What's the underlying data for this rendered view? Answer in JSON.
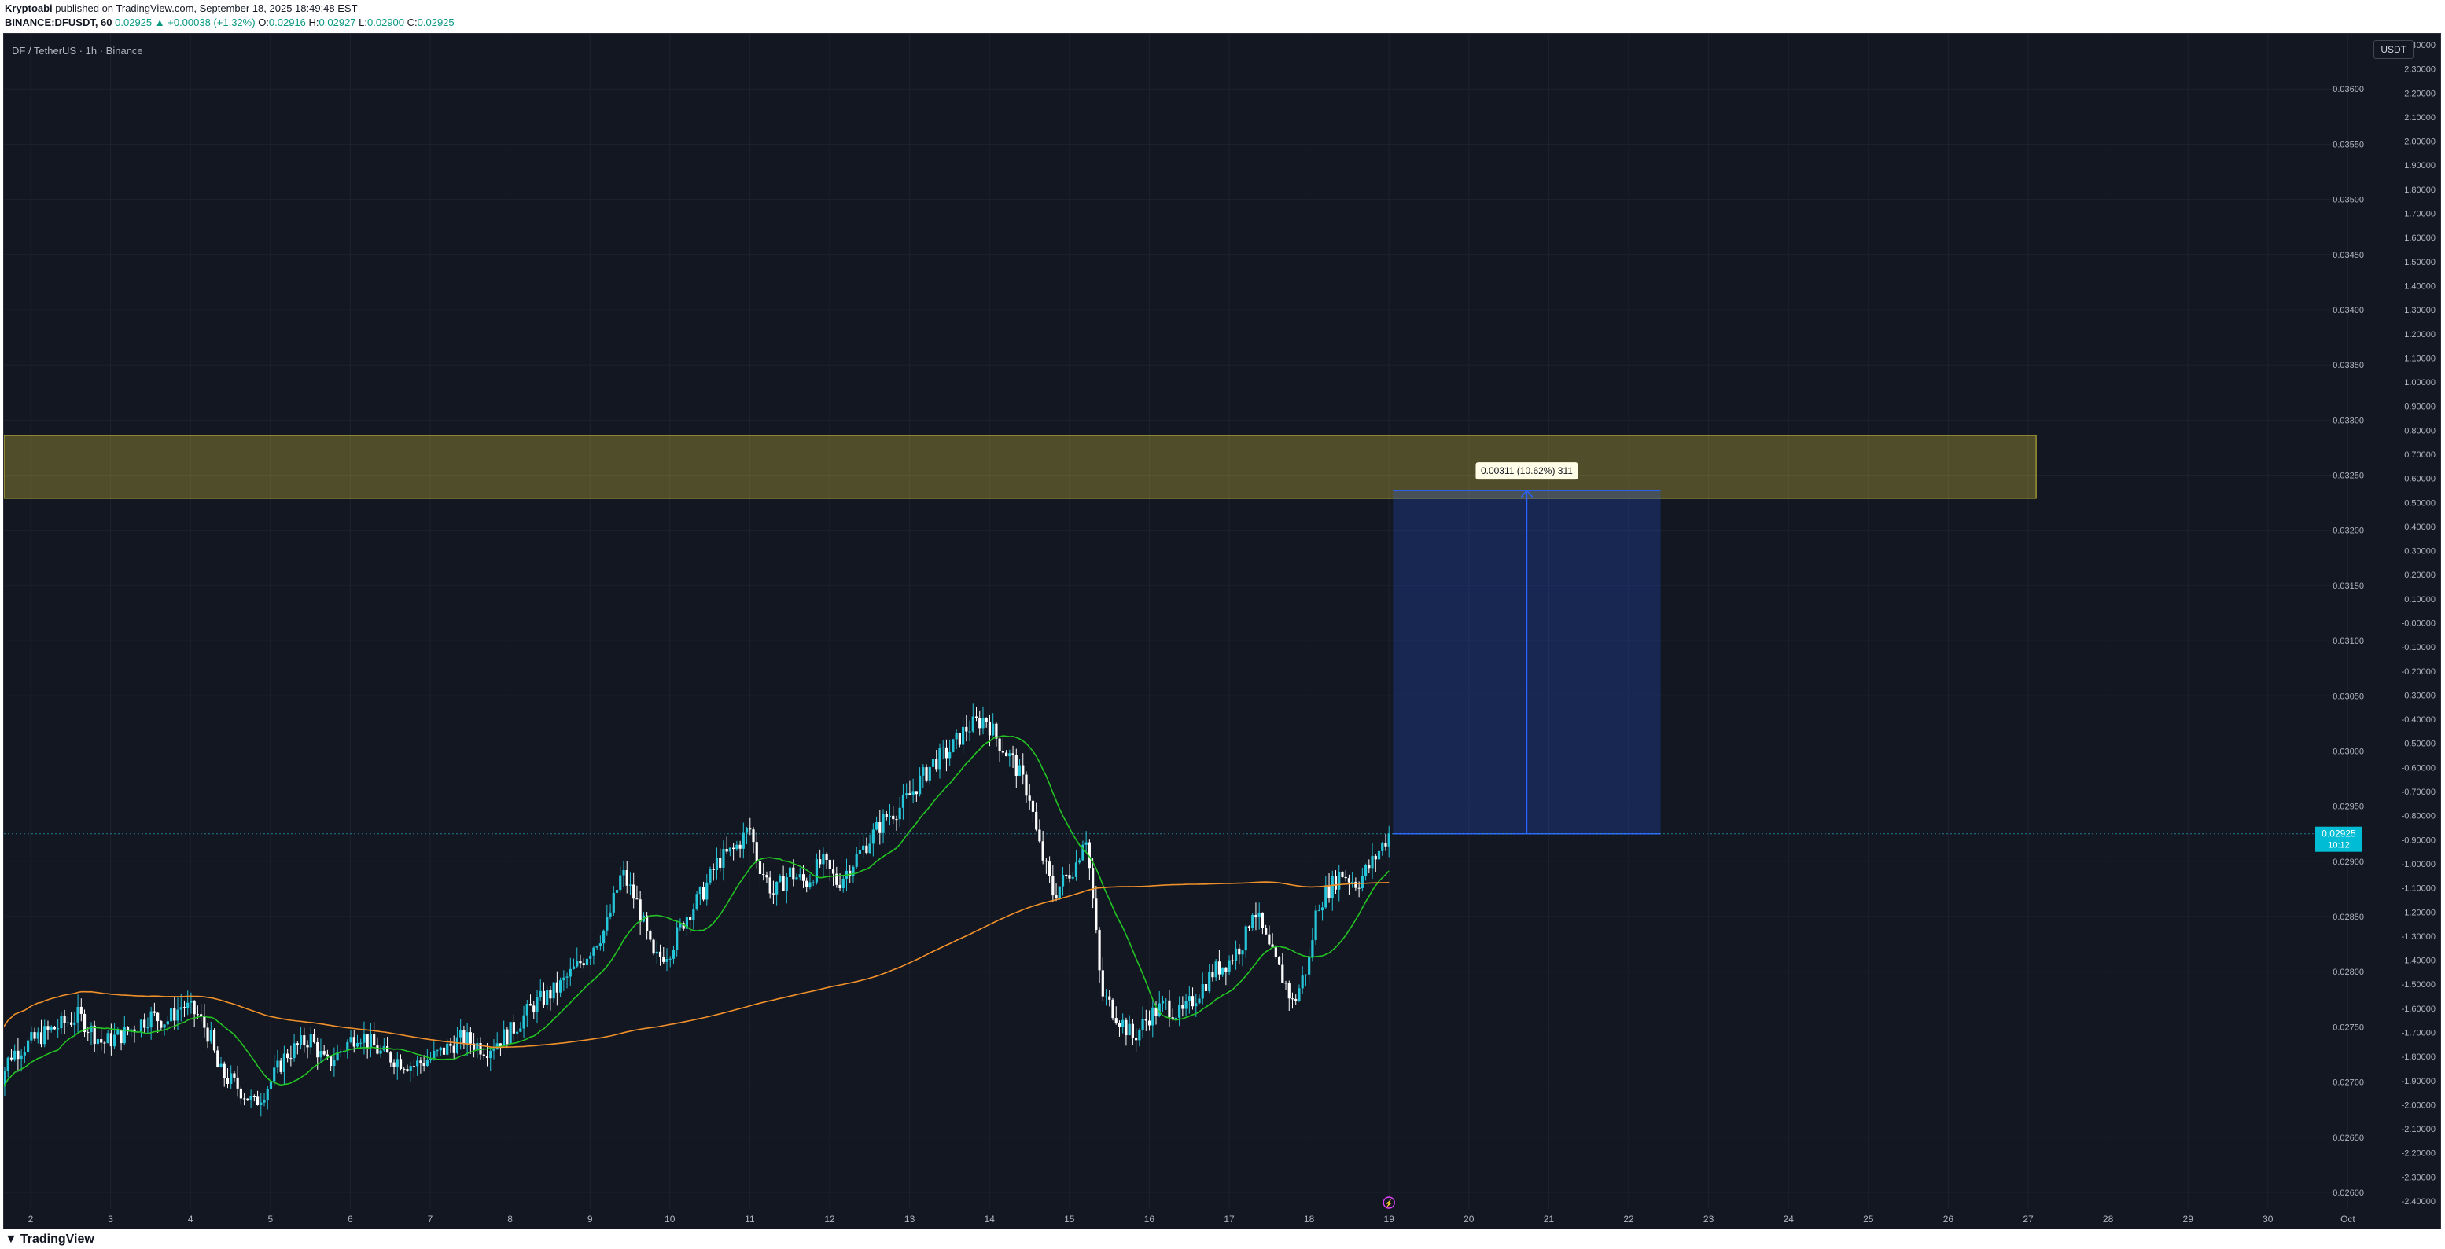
{
  "header": {
    "author": "Kryptoabi",
    "published": "published on TradingView.com, September 18, 2025 18:49:48 EST",
    "symbol": "BINANCE:DFUSDT, 60",
    "last": "0.02925",
    "change": "▲ +0.00038 (+1.32%)",
    "o_label": "O:",
    "o_value": "0.02916",
    "h_label": "H:",
    "h_value": "0.02927",
    "l_label": "L:",
    "l_value": "0.02900",
    "c_label": "C:",
    "c_value": "0.02925"
  },
  "chart": {
    "symbol_label": "DF / TetherUS · 1h · Binance",
    "currency": "USDT",
    "last_price_tag": "0.02925",
    "countdown": "10:12",
    "measure_label": "0.00311 (10.62%) 311",
    "colors": {
      "background": "#131722",
      "up": "#26c6da",
      "down": "#ffffff",
      "ma_fast": "#22c322",
      "ma_slow": "#f0902a",
      "zone": "#f0e040",
      "measure": "#2962ff"
    }
  },
  "footer": {
    "logo": "TradingView"
  },
  "chart_data": {
    "type": "candlestick",
    "title": "DF / TetherUS · 1h · Binance",
    "x_ticks": [
      "2",
      "3",
      "4",
      "5",
      "6",
      "7",
      "8",
      "9",
      "10",
      "11",
      "12",
      "13",
      "14",
      "15",
      "16",
      "17",
      "18",
      "19",
      "20",
      "21",
      "22",
      "23",
      "24",
      "25",
      "26",
      "27",
      "28",
      "29",
      "30",
      "Oct"
    ],
    "y_ticks_price": [
      "0.03600",
      "0.03550",
      "0.03500",
      "0.03450",
      "0.03400",
      "0.03350",
      "0.03300",
      "0.03250",
      "0.03200",
      "0.03150",
      "0.03100",
      "0.03050",
      "0.03000",
      "0.02950",
      "0.02900",
      "0.02850",
      "0.02800",
      "0.02750",
      "0.02700",
      "0.02650",
      "0.02600"
    ],
    "y_ticks_secondary": [
      "2.40000",
      "2.30000",
      "2.20000",
      "2.10000",
      "2.00000",
      "1.90000",
      "1.80000",
      "1.70000",
      "1.60000",
      "1.50000",
      "1.40000",
      "1.30000",
      "1.20000",
      "1.10000",
      "1.00000",
      "0.90000",
      "0.80000",
      "0.70000",
      "0.60000",
      "0.50000",
      "0.40000",
      "0.30000",
      "0.20000",
      "0.10000",
      "-0.00000",
      "-0.10000",
      "-0.20000",
      "-0.30000",
      "-0.40000",
      "-0.50000",
      "-0.60000",
      "-0.70000",
      "-0.80000",
      "-0.90000",
      "-1.00000",
      "-1.10000",
      "-1.20000",
      "-1.30000",
      "-1.40000",
      "-1.50000",
      "-1.60000",
      "-1.70000",
      "-1.80000",
      "-1.90000",
      "-2.00000",
      "-2.10000",
      "-2.20000",
      "-2.30000",
      "-2.40000"
    ],
    "ylim": [
      0.02585,
      0.0365
    ],
    "close_path": [
      [
        1.55,
        0.0269
      ],
      [
        1.75,
        0.02725
      ],
      [
        2.2,
        0.02745
      ],
      [
        2.6,
        0.0276
      ],
      [
        2.9,
        0.02735
      ],
      [
        3.2,
        0.02745
      ],
      [
        3.5,
        0.0276
      ],
      [
        3.7,
        0.02755
      ],
      [
        3.9,
        0.0277
      ],
      [
        4.1,
        0.0276
      ],
      [
        4.25,
        0.0274
      ],
      [
        4.35,
        0.0271
      ],
      [
        4.6,
        0.02695
      ],
      [
        4.8,
        0.0268
      ],
      [
        5.0,
        0.027
      ],
      [
        5.2,
        0.02725
      ],
      [
        5.5,
        0.0274
      ],
      [
        5.7,
        0.02715
      ],
      [
        5.9,
        0.0273
      ],
      [
        6.1,
        0.02745
      ],
      [
        6.4,
        0.02725
      ],
      [
        6.8,
        0.02715
      ],
      [
        7.1,
        0.02725
      ],
      [
        7.4,
        0.0274
      ],
      [
        7.7,
        0.0273
      ],
      [
        8.0,
        0.02745
      ],
      [
        8.3,
        0.0277
      ],
      [
        8.6,
        0.02785
      ],
      [
        8.9,
        0.0281
      ],
      [
        9.2,
        0.0284
      ],
      [
        9.4,
        0.0289
      ],
      [
        9.6,
        0.0286
      ],
      [
        9.8,
        0.0281
      ],
      [
        10.0,
        0.0282
      ],
      [
        10.2,
        0.0285
      ],
      [
        10.4,
        0.0287
      ],
      [
        10.6,
        0.029
      ],
      [
        10.8,
        0.0291
      ],
      [
        11.0,
        0.0293
      ],
      [
        11.1,
        0.029
      ],
      [
        11.3,
        0.0287
      ],
      [
        11.5,
        0.0289
      ],
      [
        11.7,
        0.0288
      ],
      [
        11.9,
        0.029
      ],
      [
        12.1,
        0.0288
      ],
      [
        12.3,
        0.029
      ],
      [
        12.5,
        0.0292
      ],
      [
        12.7,
        0.0294
      ],
      [
        12.9,
        0.0295
      ],
      [
        13.1,
        0.0297
      ],
      [
        13.3,
        0.0299
      ],
      [
        13.5,
        0.03
      ],
      [
        13.7,
        0.0302
      ],
      [
        13.95,
        0.0303
      ],
      [
        14.1,
        0.0301
      ],
      [
        14.3,
        0.0299
      ],
      [
        14.5,
        0.0296
      ],
      [
        14.6,
        0.0292
      ],
      [
        14.8,
        0.0287
      ],
      [
        15.0,
        0.0289
      ],
      [
        15.1,
        0.029
      ],
      [
        15.2,
        0.0293
      ],
      [
        15.3,
        0.0286
      ],
      [
        15.4,
        0.0278
      ],
      [
        15.5,
        0.0277
      ],
      [
        15.7,
        0.0275
      ],
      [
        15.8,
        0.0274
      ],
      [
        16.0,
        0.0276
      ],
      [
        16.2,
        0.0277
      ],
      [
        16.4,
        0.0276
      ],
      [
        16.6,
        0.0278
      ],
      [
        16.8,
        0.028
      ],
      [
        17.0,
        0.0281
      ],
      [
        17.2,
        0.0283
      ],
      [
        17.3,
        0.0286
      ],
      [
        17.5,
        0.0282
      ],
      [
        17.7,
        0.0279
      ],
      [
        17.8,
        0.0277
      ],
      [
        18.0,
        0.0281
      ],
      [
        18.1,
        0.0286
      ],
      [
        18.4,
        0.0289
      ],
      [
        18.6,
        0.0288
      ],
      [
        18.8,
        0.029
      ],
      [
        19.0,
        0.02925
      ]
    ],
    "range_zone": [
      0.03229,
      0.03286
    ],
    "measure": {
      "from_price": 0.02925,
      "to_price": 0.03236,
      "change": "0.00311 (10.62%) 311"
    },
    "last_price": 0.02925
  }
}
